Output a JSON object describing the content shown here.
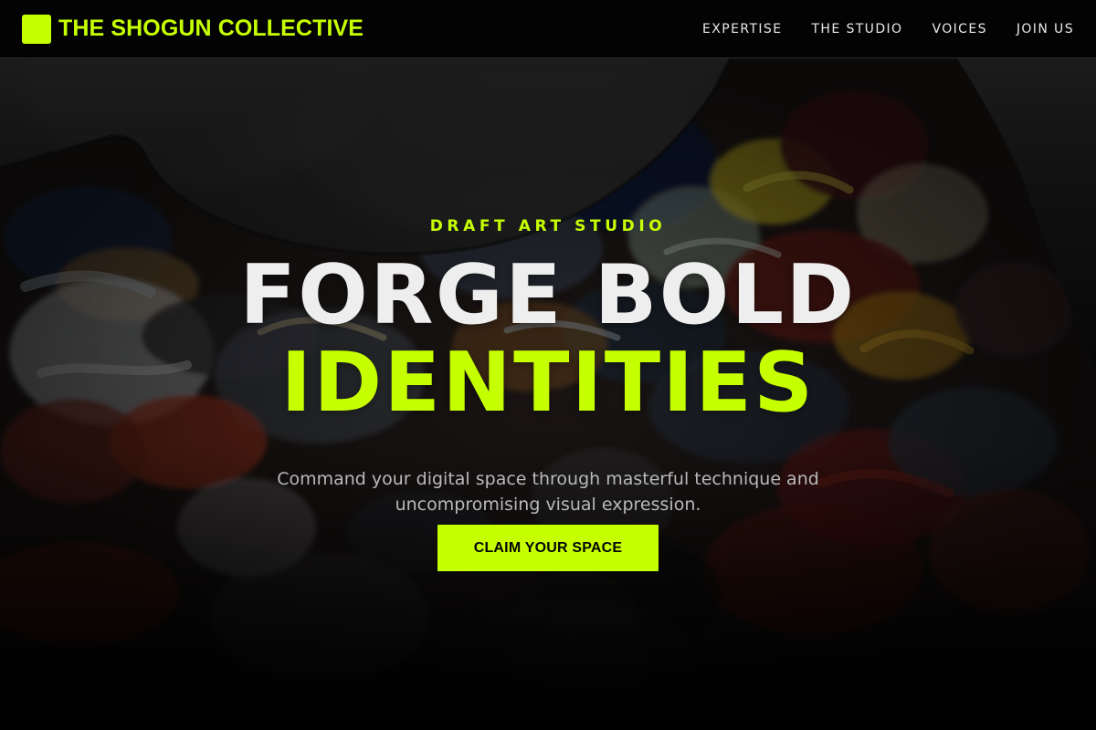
{
  "brand": {
    "name": "THE SHOGUN COLLECTIVE",
    "logo_icon": "square-logo-icon"
  },
  "nav": {
    "items": [
      {
        "label": "EXPERTISE"
      },
      {
        "label": "THE STUDIO"
      },
      {
        "label": "VOICES"
      },
      {
        "label": "JOIN US"
      }
    ]
  },
  "hero": {
    "eyebrow": "DRAFT ART STUDIO",
    "headline_line1": "FORGE BOLD",
    "headline_line2": "IDENTITIES",
    "subcopy": "Command your digital space through masterful technique and uncompromising visual expression.",
    "cta_label": "CLAIM YOUR SPACE",
    "background": "paint-palette-illustration"
  },
  "colors": {
    "accent": "#C6FF00",
    "background": "#070707",
    "header": "#030303",
    "text_light": "#EEEEEE",
    "text_muted": "#B9B9B9"
  }
}
